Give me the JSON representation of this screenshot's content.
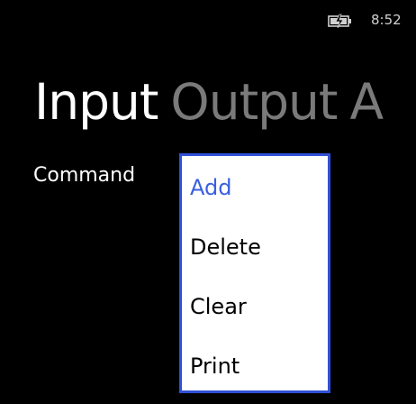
{
  "status_bar": {
    "time": "8:52",
    "battery_icon": "battery-charging-icon"
  },
  "pivot": {
    "tabs": [
      {
        "label": "Input",
        "active": true
      },
      {
        "label": "Output",
        "active": false
      },
      {
        "label": "A",
        "active": false
      }
    ]
  },
  "form": {
    "command_label": "Command"
  },
  "list_picker": {
    "items": [
      "Add",
      "Delete",
      "Clear",
      "Print"
    ],
    "selected": "Add",
    "colors": {
      "accent": "#3a5fe0",
      "border": "#3050d8",
      "background": "#ffffff"
    }
  },
  "theme": {
    "background": "#000000",
    "foreground": "#ffffff",
    "inactive": "#7a7a7a"
  }
}
